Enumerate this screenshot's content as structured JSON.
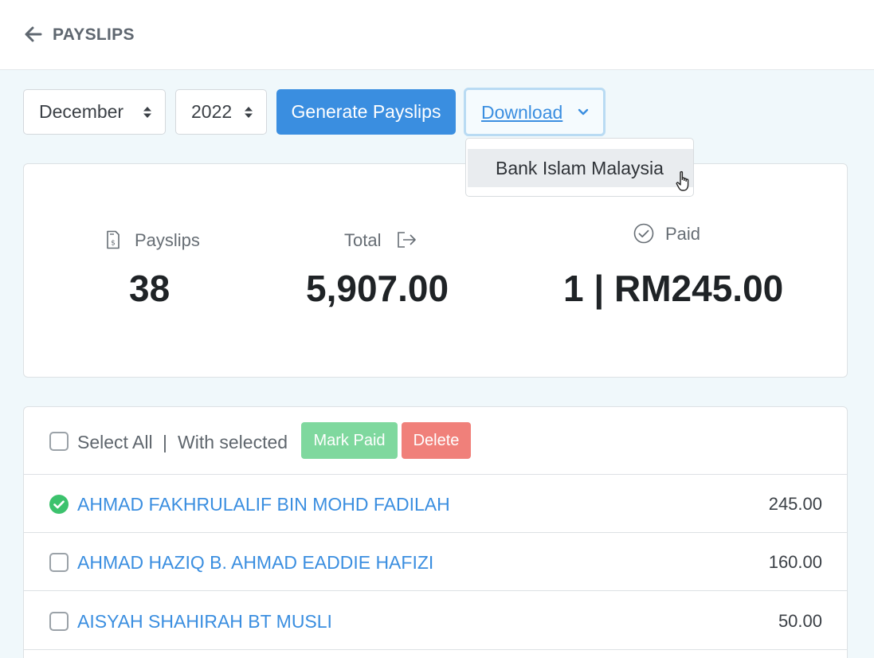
{
  "header": {
    "title": "PAYSLIPS",
    "back_icon": "arrow-left-icon"
  },
  "toolbar": {
    "month": "December",
    "year": "2022",
    "generate_label": "Generate Payslips",
    "download_label": "Download",
    "download_menu": [
      {
        "label": "Bank Islam Malaysia"
      }
    ]
  },
  "stats": {
    "payslips_label": "Payslips",
    "payslips_value": "38",
    "total_label": "Total",
    "total_value": "5,907.00",
    "paid_label": "Paid",
    "paid_value": "1 | RM245.00"
  },
  "list": {
    "select_all_label": "Select All",
    "separator": "|",
    "with_selected_label": "With selected",
    "mark_paid_label": "Mark Paid",
    "delete_label": "Delete",
    "rows": [
      {
        "name": "AHMAD FAKHRULALIF BIN MOHD FADILAH",
        "amount": "245.00",
        "paid": true
      },
      {
        "name": "AHMAD HAZIQ B. AHMAD EADDIE HAFIZI",
        "amount": "160.00",
        "paid": false
      },
      {
        "name": "AISYAH SHAHIRAH BT MUSLI",
        "amount": "50.00",
        "paid": false
      }
    ]
  },
  "colors": {
    "accent": "#3a8ee0",
    "success": "#3cc26d",
    "mark_paid": "#7fd89e",
    "delete": "#f0807a",
    "background": "#f0f8fb"
  }
}
